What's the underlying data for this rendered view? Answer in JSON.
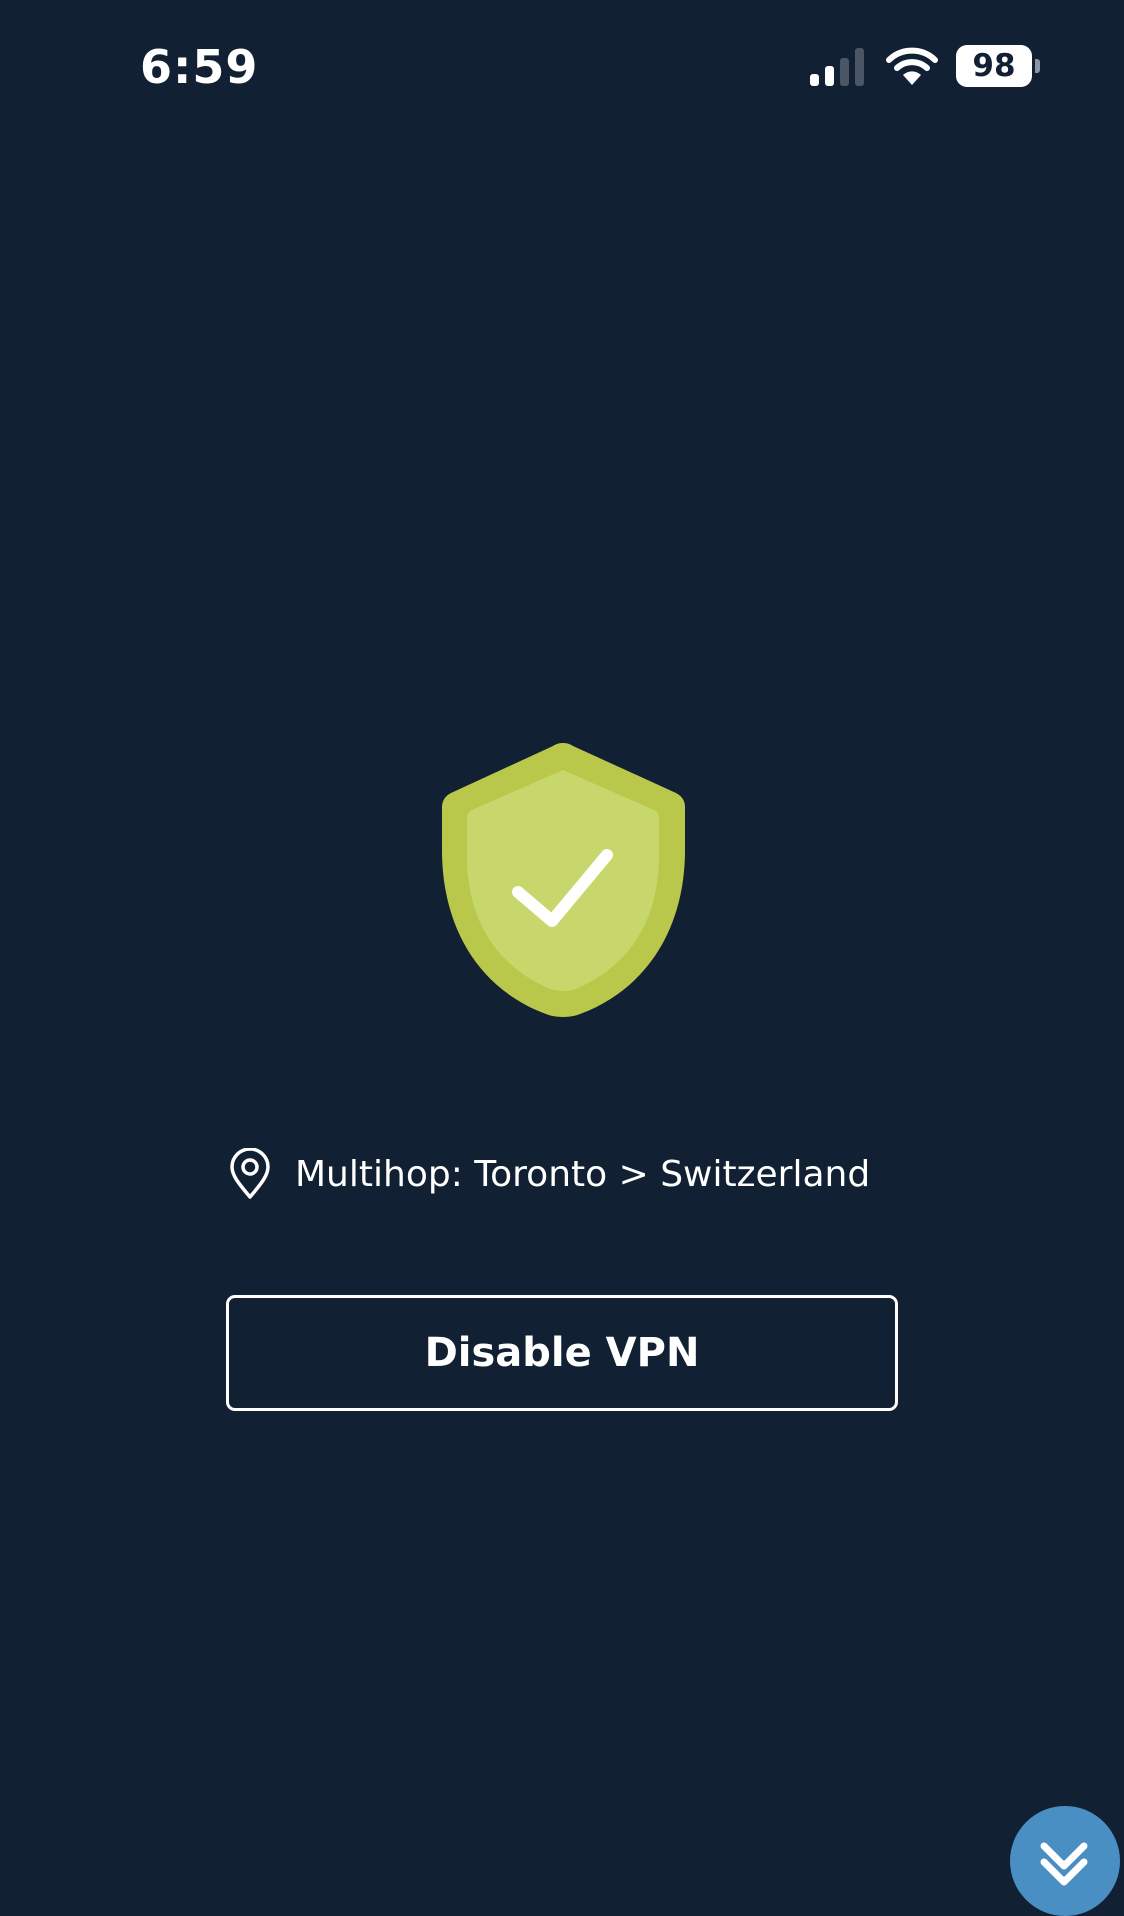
{
  "status_bar": {
    "time": "6:59",
    "battery_level": "98",
    "signal_bars_active": 2,
    "signal_bars_total": 4,
    "wifi_icon": "wifi-icon",
    "battery_icon": "battery-icon"
  },
  "vpn": {
    "status_icon": "shield-check-icon",
    "status_color": "#b9c84a",
    "location_icon": "location-pin-icon",
    "location_text": "Multihop: Toronto > Switzerland",
    "disable_button_label": "Disable VPN"
  },
  "floating_button": {
    "icon": "collapse-icon",
    "color": "#4a8fc4"
  }
}
